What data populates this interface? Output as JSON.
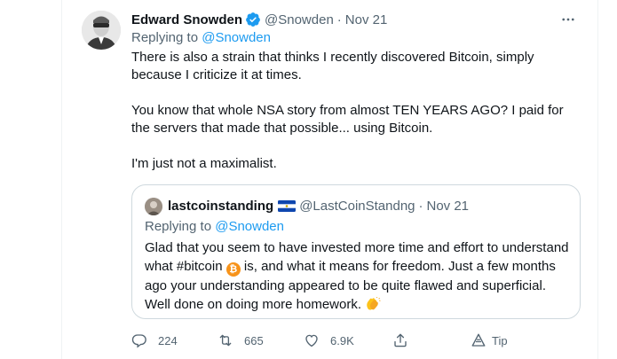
{
  "tweet": {
    "author_name": "Edward Snowden",
    "author_handle": "@Snowden",
    "separator": "·",
    "date": "Nov 21",
    "replying_prefix": "Replying to",
    "replying_to": "@Snowden",
    "paragraphs": [
      "There is also a strain that thinks I recently discovered Bitcoin, simply because I criticize it at times.",
      "You know that whole NSA story from almost TEN YEARS AGO? I paid for the servers that made that possible... using Bitcoin.",
      "I'm just not a maximalist."
    ]
  },
  "quote": {
    "author_name": "lastcoinstanding",
    "author_handle": "@LastCoinStandng",
    "separator": "·",
    "date": "Nov 21",
    "replying_prefix": "Replying to",
    "replying_to": "@Snowden",
    "text_part1": "Glad that you seem to have invested more time and effort to understand what #bitcoin ",
    "bitcoin_glyph": "₿",
    "text_part2": " is, and what it means for freedom. Just a few months ago your understanding appeared to be quite flawed and superficial. Well done on doing more homework. "
  },
  "actions": {
    "replies": "224",
    "retweets": "665",
    "likes": "6.9K",
    "tip_label": "Tip"
  },
  "colors": {
    "link": "#1d9bf0",
    "muted": "#536471",
    "verified": "#1d9bf0",
    "border": "#cfd9de"
  }
}
